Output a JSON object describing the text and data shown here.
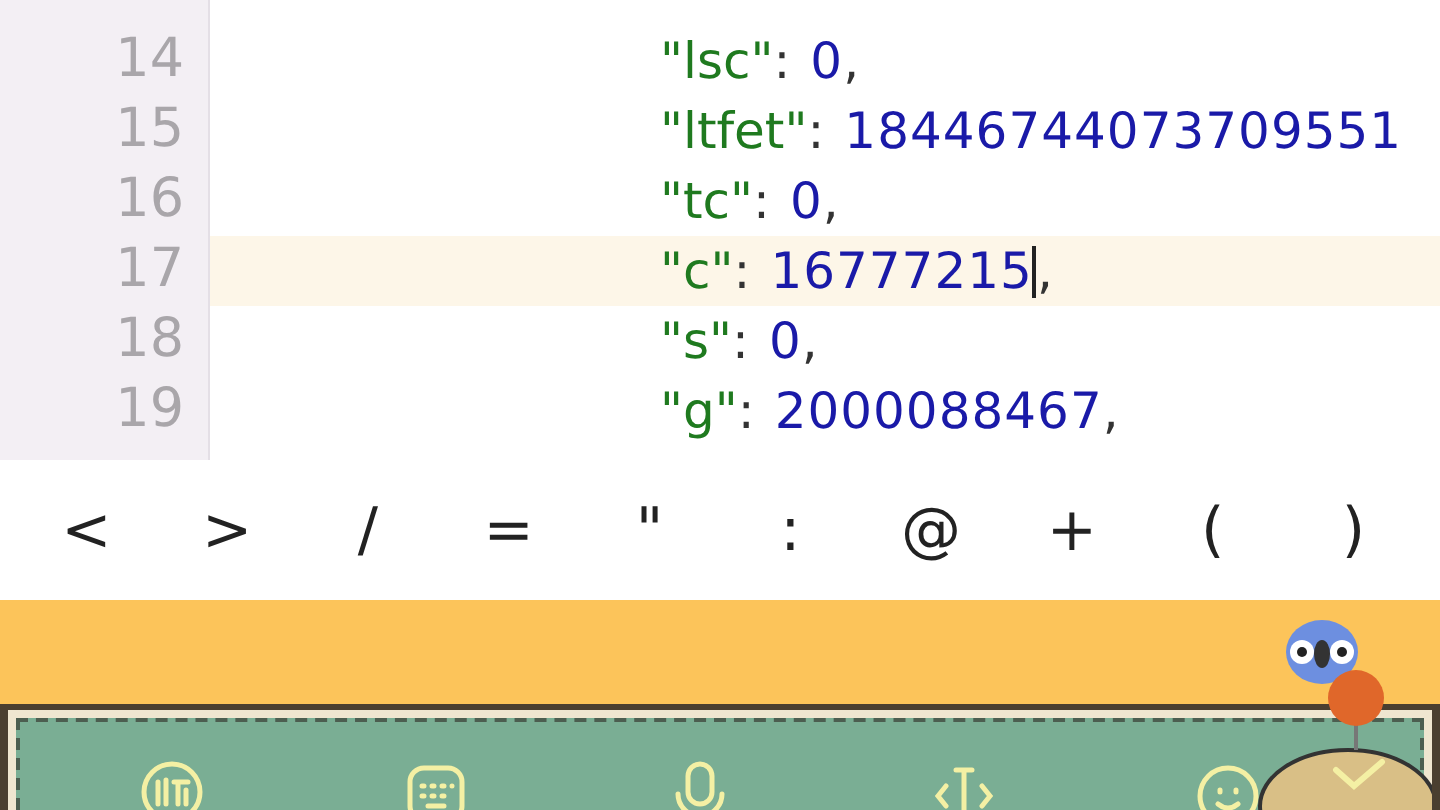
{
  "editor": {
    "lines": [
      {
        "number": "14",
        "key": "\"lsc\"",
        "colon": ":",
        "value": "0",
        "comma": ",",
        "current": false
      },
      {
        "number": "15",
        "key": "\"ltfet\"",
        "colon": ":",
        "value": "18446744073709551",
        "current": false
      },
      {
        "number": "16",
        "key": "\"tc\"",
        "colon": ":",
        "value": "0",
        "comma": ",",
        "current": false
      },
      {
        "number": "17",
        "key": "\"c\"",
        "colon": ":",
        "value": "16777215",
        "comma": ",",
        "current": true
      },
      {
        "number": "18",
        "key": "\"s\"",
        "colon": ":",
        "value": "0",
        "comma": ",",
        "current": false
      },
      {
        "number": "19",
        "key": "\"g\"",
        "colon": ":",
        "value": "2000088467",
        "comma": ",",
        "current": false
      }
    ]
  },
  "symbol_bar": {
    "keys": [
      "<",
      ">",
      "/",
      "=",
      "\"",
      ":",
      "@",
      "+",
      "(",
      ")"
    ]
  },
  "keyboard_toolbar": {
    "items": [
      {
        "kind": "logo"
      },
      {
        "kind": "keyboard"
      },
      {
        "kind": "mic"
      },
      {
        "kind": "cursor"
      },
      {
        "kind": "emoji"
      },
      {
        "kind": "done"
      }
    ]
  }
}
